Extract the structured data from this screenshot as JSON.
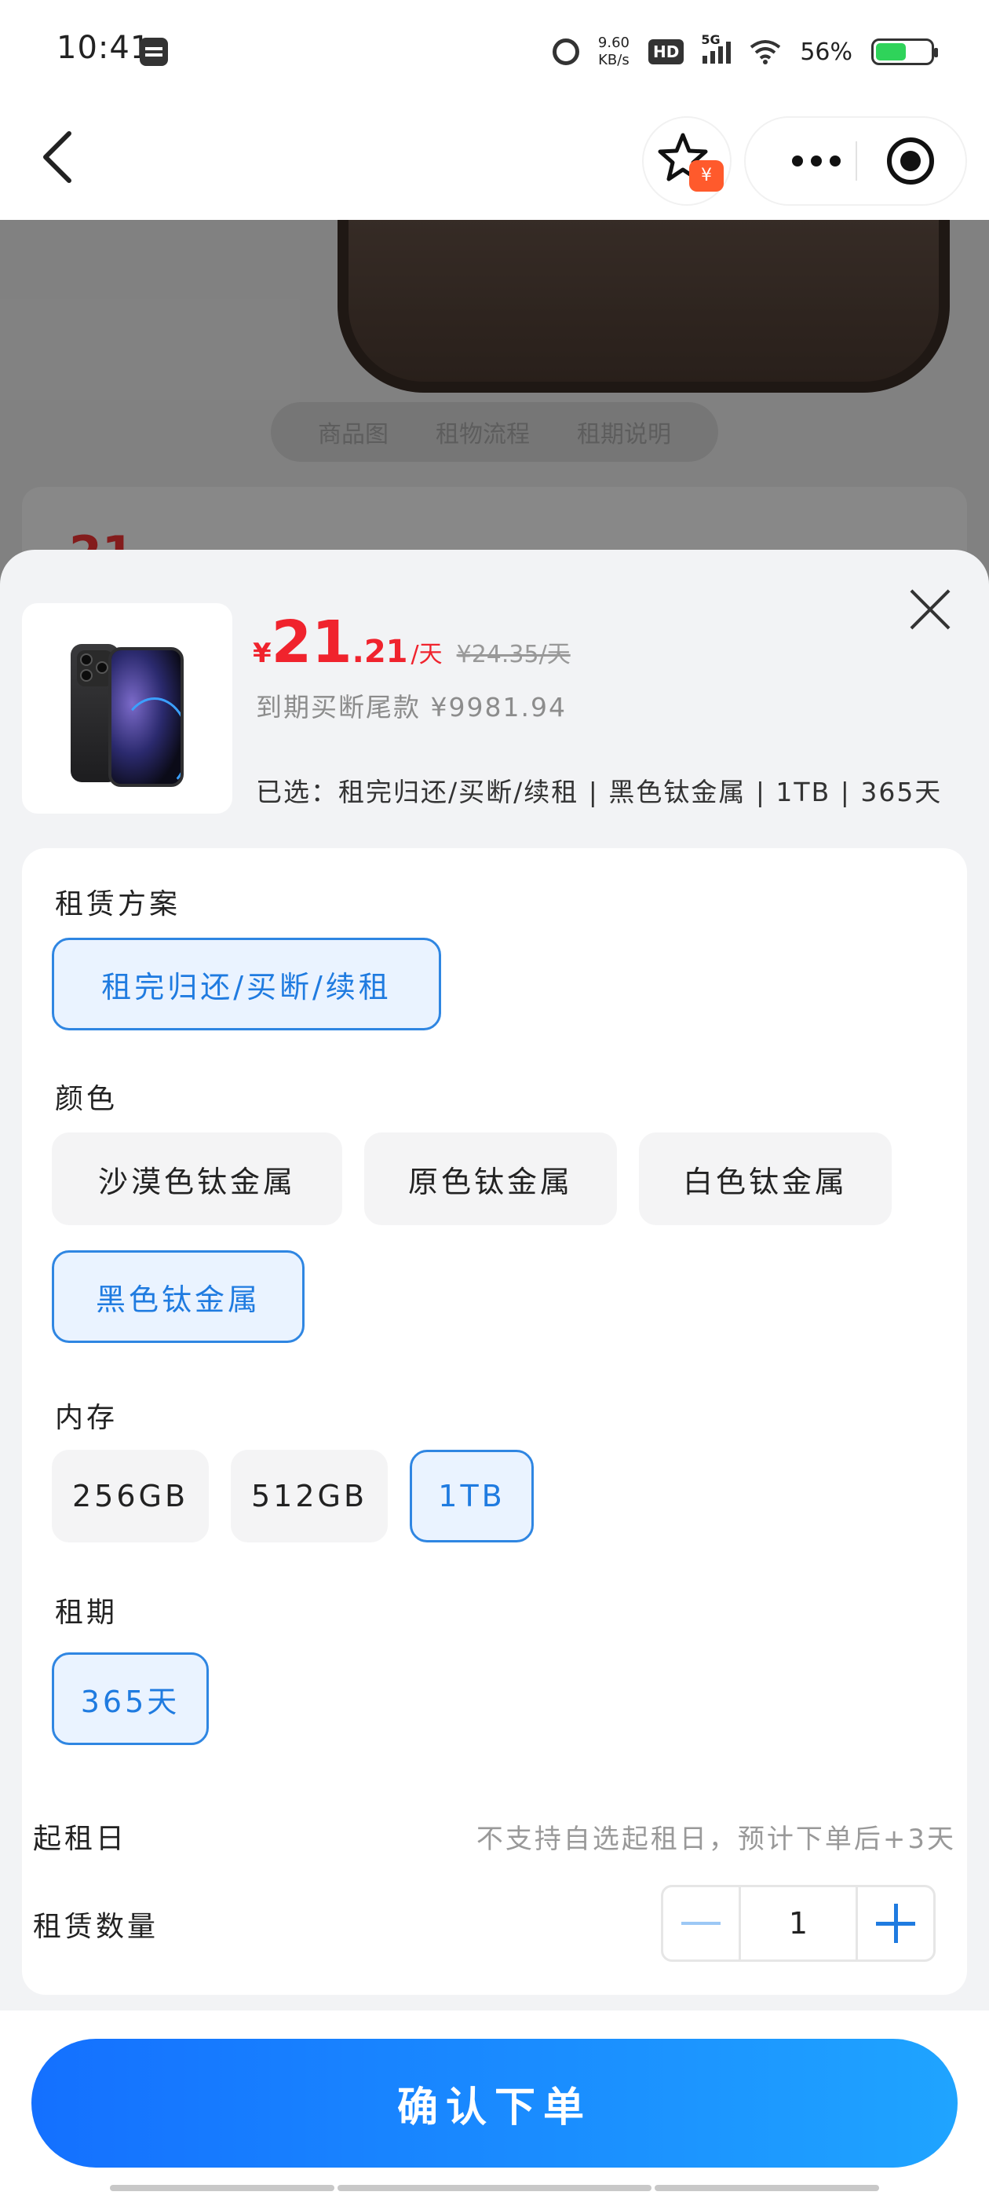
{
  "status_bar": {
    "time": "10:41",
    "speed_top": "9.60",
    "speed_unit": "KB/s",
    "hd": "HD",
    "network": "5G",
    "battery": "56%",
    "battery_level": 0.56
  },
  "nav": {
    "fav_badge": "¥"
  },
  "background": {
    "tabs": [
      "商品图",
      "租物流程",
      "租期说明"
    ],
    "price_peek": "21"
  },
  "sheet": {
    "price": {
      "currency": "¥",
      "integer": "21",
      "decimal": ".21",
      "unit": "/天",
      "original": "¥24.35/天"
    },
    "buyout_text": "到期买断尾款 ¥9981.94",
    "selected_text": "已选：租完归还/买断/续租 | 黑色钛金属 | 1TB | 365天",
    "sections": {
      "plan": {
        "title": "租赁方案",
        "options": [
          "租完归还/买断/续租"
        ]
      },
      "color": {
        "title": "颜色",
        "options": [
          "沙漠色钛金属",
          "原色钛金属",
          "白色钛金属",
          "黑色钛金属"
        ]
      },
      "storage": {
        "title": "内存",
        "options": [
          "256GB",
          "512GB",
          "1TB"
        ]
      },
      "term": {
        "title": "租期",
        "options": [
          "365天"
        ]
      }
    },
    "start_date": {
      "label": "起租日",
      "value": "不支持自选起租日，预计下单后+3天"
    },
    "quantity": {
      "label": "租赁数量",
      "value": "1"
    },
    "confirm_label": "确认下单"
  },
  "colors": {
    "accent": "#1f7be0",
    "price": "#f0232d",
    "button_start": "#1470ff",
    "button_end": "#1fa4ff"
  },
  "icons": {
    "back": "chevron-left-icon",
    "favorite": "star-icon",
    "more": "more-dots-icon",
    "close_miniprogram": "target-icon",
    "close_sheet": "close-icon",
    "stepper_minus": "minus-icon",
    "stepper_plus": "plus-icon"
  }
}
